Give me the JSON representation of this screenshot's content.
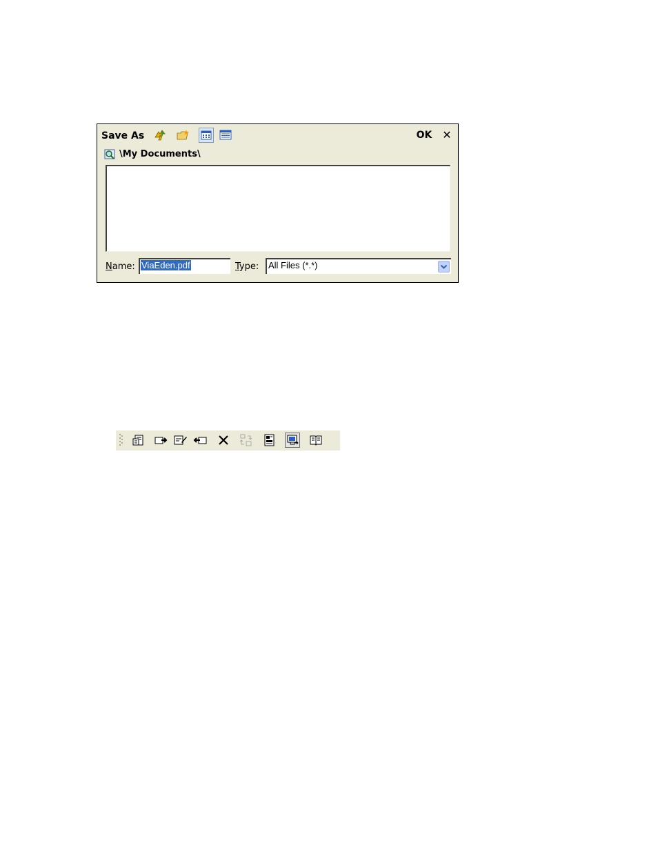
{
  "dialog": {
    "title": "Save As",
    "ok_label": "OK",
    "close_symbol": "✕",
    "icons": [
      "up-folder-icon",
      "new-folder-icon",
      "list-view-icon",
      "details-view-icon"
    ],
    "path": "\\My Documents\\",
    "path_icon": "magnifier-icon",
    "name_label_first": "N",
    "name_label_rest": "ame:",
    "name_value": "ViaEden.pdf",
    "type_label_first": "T",
    "type_label_rest": "ype:",
    "type_value": "All Files (*.*)",
    "colors": {
      "dialog_bg": "#ecead8",
      "selection": "#316ac5",
      "dropdown": "#c1d3fb"
    }
  },
  "toolbar": {
    "icons": [
      "page-properties-icon",
      "export-page-icon",
      "edit-page-icon",
      "import-page-icon",
      "delete-icon",
      "swap-pages-icon",
      "page-layout-icon",
      "monitor-view-icon",
      "book-icon"
    ]
  }
}
